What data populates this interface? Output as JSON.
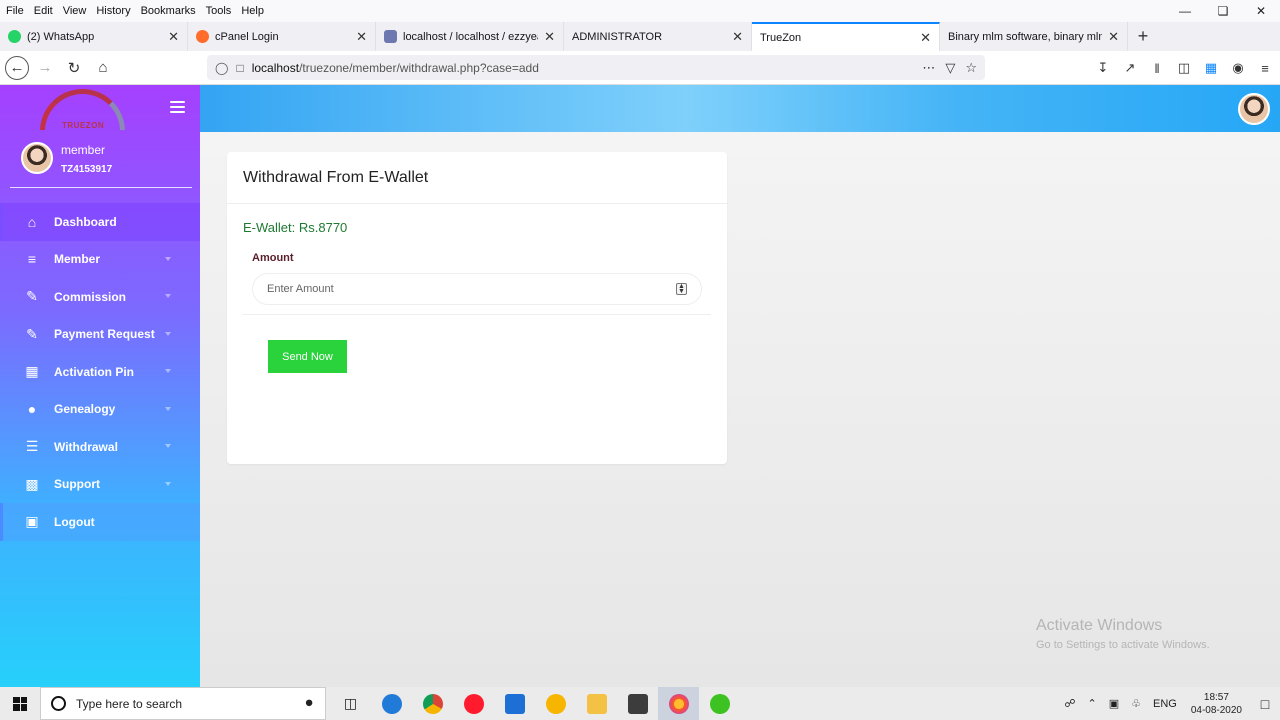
{
  "browser": {
    "menu": [
      "File",
      "Edit",
      "View",
      "History",
      "Bookmarks",
      "Tools",
      "Help"
    ],
    "tabs": [
      {
        "label": "(2) WhatsApp",
        "color": "#25d366"
      },
      {
        "label": "cPanel Login",
        "color": "#ff6c2c"
      },
      {
        "label": "localhost / localhost / ezzyearn",
        "color": "#6c78af"
      },
      {
        "label": "ADMINISTRATOR",
        "color": "#cccccc"
      },
      {
        "label": "TrueZon",
        "color": "#ffffff"
      },
      {
        "label": "Binary mlm software, binary mlm so",
        "color": "#cccccc"
      }
    ],
    "url_host": "localhost",
    "url_path": "/truezone/member/withdrawal.php?case=add"
  },
  "app": {
    "logo_text": "TRUEZON",
    "user_name": "member",
    "user_id": "TZ4153917",
    "menu": [
      {
        "label": "Dashboard",
        "icon": "home-icon"
      },
      {
        "label": "Member",
        "icon": "layers-icon"
      },
      {
        "label": "Commission",
        "icon": "edit-icon"
      },
      {
        "label": "Payment Request",
        "icon": "edit-icon"
      },
      {
        "label": "Activation Pin",
        "icon": "table-icon"
      },
      {
        "label": "Genealogy",
        "icon": "user-icon"
      },
      {
        "label": "Withdrawal",
        "icon": "list-icon"
      },
      {
        "label": "Support",
        "icon": "bar-chart-icon"
      },
      {
        "label": "Logout",
        "icon": "lock-icon"
      }
    ]
  },
  "card": {
    "title": "Withdrawal From E-Wallet",
    "wallet": "E-Wallet: Rs.8770",
    "amount_label": "Amount",
    "amount_placeholder": "Enter Amount",
    "send_label": "Send Now"
  },
  "watermark": {
    "line1": "Activate Windows",
    "line2": "Go to Settings to activate Windows."
  },
  "taskbar": {
    "search_placeholder": "Type here to search",
    "lang": "ENG",
    "time": "18:57",
    "date": "04-08-2020"
  }
}
